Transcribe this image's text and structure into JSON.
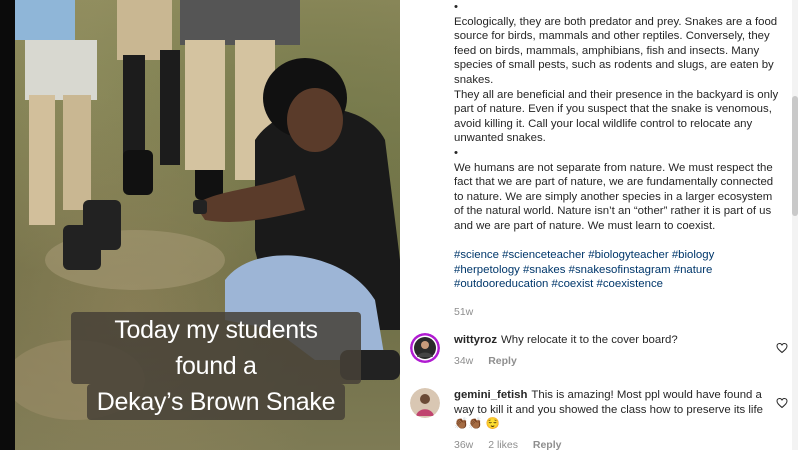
{
  "post": {
    "caption_overlay": [
      "Today my students found a",
      "Dekay’s Brown Snake"
    ],
    "bullet_char": "•",
    "paragraph1": "Ecologically, they are both predator and prey. Snakes are a food source for birds, mammals and other reptiles. Conversely, they feed on birds, mammals, amphibians, fish and insects. Many species of small pests, such as rodents and slugs, are eaten by snakes.",
    "paragraph2": "They all are beneficial and their presence in the backyard is only part of nature. Even if you suspect that the snake is venomous, avoid killing it. Call your local wildlife control to relocate any unwanted snakes.",
    "paragraph3": "We humans are not separate from nature. We must respect the fact that we are part of nature, we are fundamentally connected to nature. We are simply another species in a larger ecosystem of the natural world. Nature isn’t an “other” rather it is part of us and we are part of nature. We must learn to coexist.",
    "hashtags": [
      "#science",
      "#scienceteacher",
      "#biologyteacher",
      "#biology",
      "#herpetology",
      "#snakes",
      "#snakesofinstagram",
      "#nature",
      "#outdooreducation",
      "#coexist",
      "#coexistence"
    ],
    "timestamp": "51w"
  },
  "comments": [
    {
      "username": "wittyroz",
      "text": "Why relocate it to the cover board?",
      "age": "34w",
      "reply_label": "Reply",
      "icon": "heart-outline-icon"
    },
    {
      "username": "gemini_fetish",
      "text": "This is amazing! Most ppl would have found a way to kill it and you showed the class how to preserve its life👏🏾👏🏾 😌",
      "age": "36w",
      "likes_label": "2 likes",
      "reply_label": "Reply",
      "icon": "heart-outline-icon"
    }
  ],
  "colors": {
    "hashtag": "#00376b",
    "meta_grey": "#8e8e8e",
    "text": "#262626"
  }
}
